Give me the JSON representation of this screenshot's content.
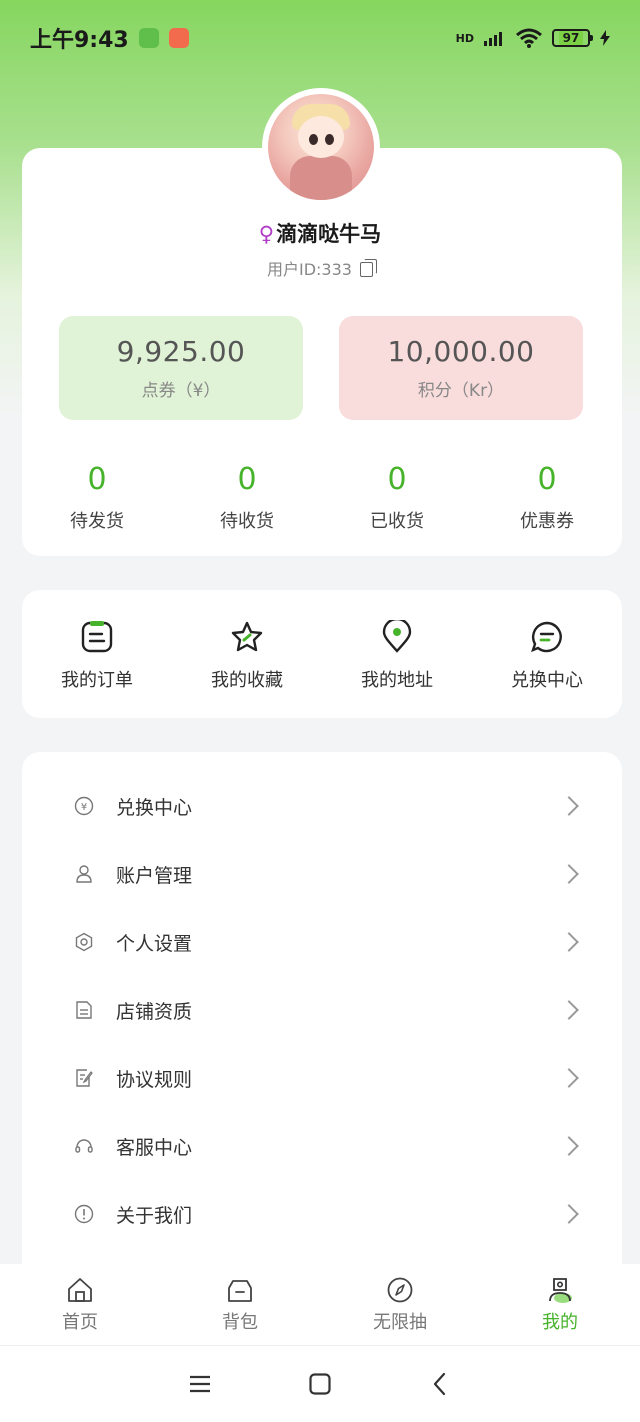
{
  "status_bar": {
    "time": "上午9:43",
    "network": "HD",
    "battery": "97"
  },
  "profile": {
    "gender_symbol": "♀",
    "name": "滴滴哒牛马",
    "user_id": "用户ID:333"
  },
  "balances": [
    {
      "value": "9,925.00",
      "label": "点券（¥）"
    },
    {
      "value": "10,000.00",
      "label": "积分（Kr）"
    }
  ],
  "order_stats": [
    {
      "count": "0",
      "label": "待发货"
    },
    {
      "count": "0",
      "label": "待收货"
    },
    {
      "count": "0",
      "label": "已收货"
    },
    {
      "count": "0",
      "label": "优惠券"
    }
  ],
  "quick_actions": [
    {
      "label": "我的订单",
      "icon": "order-icon"
    },
    {
      "label": "我的收藏",
      "icon": "star-icon"
    },
    {
      "label": "我的地址",
      "icon": "location-icon"
    },
    {
      "label": "兑换中心",
      "icon": "chat-icon"
    }
  ],
  "menu": [
    {
      "label": "兑换中心",
      "icon": "yen-coin-icon"
    },
    {
      "label": "账户管理",
      "icon": "user-icon"
    },
    {
      "label": "个人设置",
      "icon": "settings-icon"
    },
    {
      "label": "店铺资质",
      "icon": "document-icon"
    },
    {
      "label": "协议规则",
      "icon": "edit-doc-icon"
    },
    {
      "label": "客服中心",
      "icon": "headset-icon"
    },
    {
      "label": "关于我们",
      "icon": "info-icon"
    }
  ],
  "bottom_nav": [
    {
      "label": "首页",
      "icon": "home-icon"
    },
    {
      "label": "背包",
      "icon": "bag-icon"
    },
    {
      "label": "无限抽",
      "icon": "compass-icon"
    },
    {
      "label": "我的",
      "icon": "profile-icon",
      "active": true
    }
  ],
  "colors": {
    "accent": "#47b32b",
    "header_green": "#86d65f",
    "balance_green": "#e0f3d6",
    "balance_pink": "#f9dcdc"
  }
}
